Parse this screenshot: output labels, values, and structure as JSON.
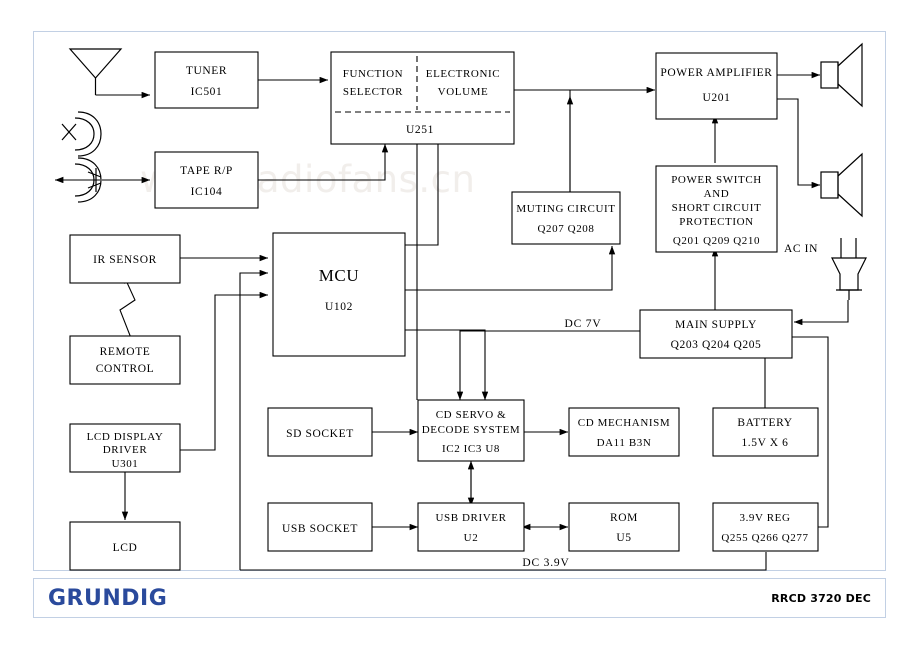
{
  "document": {
    "brand": "GRUNDIG",
    "model_code": "RRCD 3720 DEC",
    "watermark": "www.radiofans.cn",
    "frame_color": "#c2d0e4",
    "brand_color": "#2a4a9c"
  },
  "blocks": {
    "tuner": {
      "line1": "TUNER",
      "line2": "IC501"
    },
    "tape": {
      "line1": "TAPE  R/P",
      "line2": "IC104"
    },
    "function_selector": {
      "line1": "FUNCTION",
      "line2": "SELECTOR"
    },
    "electronic_volume": {
      "line1": "ELECTRONIC",
      "line2": "VOLUME"
    },
    "u251": {
      "line1": "U251"
    },
    "power_amp": {
      "line1": "POWER  AMPLIFIER",
      "line2": "U201"
    },
    "power_switch": {
      "line1": "POWER  SWITCH",
      "line2": "AND",
      "line3": "SHORT  CIRCUIT",
      "line4": "PROTECTION",
      "line5": "Q201   Q209   Q210"
    },
    "muting": {
      "line1": "MUTING  CIRCUIT",
      "line2": "Q207  Q208"
    },
    "ir_sensor": {
      "line1": "IR  SENSOR"
    },
    "remote": {
      "line1": "REMOTE",
      "line2": "CONTROL"
    },
    "mcu": {
      "line1": "MCU",
      "line2": "U102"
    },
    "lcd_driver": {
      "line1": "LCD  DISPLAY",
      "line2": "DRIVER",
      "line3": "U301"
    },
    "lcd": {
      "line1": "LCD"
    },
    "sd_socket": {
      "line1": "SD  SOCKET"
    },
    "usb_socket": {
      "line1": "USB  SOCKET"
    },
    "cd_servo": {
      "line1": "CD  SERVO  &",
      "line2": "DECODE  SYSTEM",
      "line3": "IC2    IC3    U8"
    },
    "cd_mechanism": {
      "line1": "CD  MECHANISM",
      "line2": "DA11  B3N"
    },
    "usb_driver": {
      "line1": "USB  DRIVER",
      "line2": "U2"
    },
    "rom": {
      "line1": "ROM",
      "line2": "U5"
    },
    "main_supply": {
      "line1": "MAIN  SUPPLY",
      "line2": "Q203    Q204    Q205"
    },
    "battery": {
      "line1": "BATTERY",
      "line2": "1.5V  X  6"
    },
    "reg": {
      "line1": "3.9V  REG",
      "line2": "Q255  Q266  Q277"
    }
  },
  "rails": {
    "dc7v": "DC  7V",
    "dc39v": "DC  3.9V"
  },
  "icons": {
    "antenna": "antenna-icon",
    "tape_head_play": "tape-head-icon",
    "tape_head_rec": "tape-head-record-icon",
    "speaker_top": "speaker-icon",
    "speaker_bottom": "speaker-icon",
    "ac_plug": "ac-plug-icon",
    "ir_link": "ir-lightning-icon"
  },
  "labels": {
    "ac_in": "AC  IN"
  }
}
